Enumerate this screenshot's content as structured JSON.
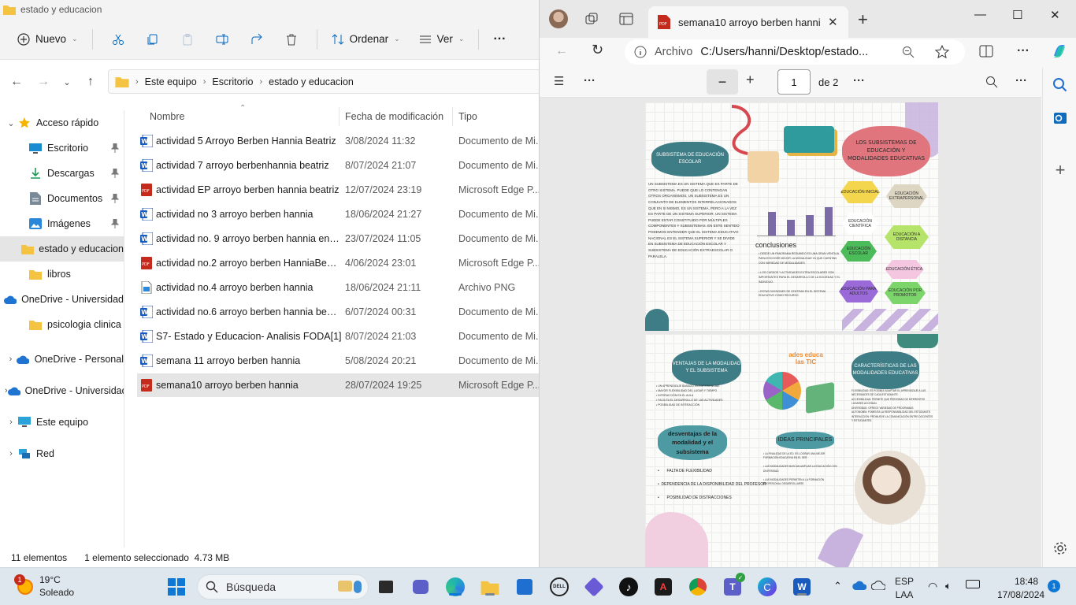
{
  "explorer": {
    "window_title": "estado y educacion",
    "toolbar": {
      "new_label": "Nuevo",
      "sort_label": "Ordenar",
      "view_label": "Ver",
      "more_label": "···"
    },
    "breadcrumb": [
      "Este equipo",
      "Escritorio",
      "estado y educacion"
    ],
    "nav": [
      {
        "label": "Acceso rápido",
        "icon": "star-icon",
        "level": 0,
        "expanded": true
      },
      {
        "label": "Escritorio",
        "icon": "desktop-icon",
        "level": 1,
        "pinned": true
      },
      {
        "label": "Descargas",
        "icon": "download-icon",
        "level": 1,
        "pinned": true
      },
      {
        "label": "Documentos",
        "icon": "document-icon",
        "level": 1,
        "pinned": true
      },
      {
        "label": "Imágenes",
        "icon": "image-icon",
        "level": 1,
        "pinned": true
      },
      {
        "label": "estado y educacion",
        "icon": "folder-icon",
        "level": 1,
        "selected": true
      },
      {
        "label": "libros",
        "icon": "folder-icon",
        "level": 1
      },
      {
        "label": "OneDrive - Universidad",
        "icon": "cloud-icon",
        "level": 1
      },
      {
        "label": "psicologia clinica",
        "icon": "folder-icon",
        "level": 1
      },
      {
        "label": "OneDrive - Personal",
        "icon": "cloud-icon",
        "level": 0
      },
      {
        "label": "OneDrive - Universidad",
        "icon": "cloud-icon",
        "level": 0
      },
      {
        "label": "Este equipo",
        "icon": "pc-icon",
        "level": 0
      },
      {
        "label": "Red",
        "icon": "network-icon",
        "level": 0
      }
    ],
    "columns": {
      "name": "Nombre",
      "date": "Fecha de modificación",
      "type": "Tipo"
    },
    "files": [
      {
        "name": "actividad 5 Arroyo Berben Hannia Beatriz",
        "date": "3/08/2024 11:32",
        "type": "Documento de Mi...",
        "kind": "word"
      },
      {
        "name": "actividad 7 arroyo berbenhannia beatriz",
        "date": "8/07/2024 21:07",
        "type": "Documento de Mi...",
        "kind": "word"
      },
      {
        "name": "actividad EP arroyo berben hannia beatriz",
        "date": "12/07/2024 23:19",
        "type": "Microsoft Edge P...",
        "kind": "pdf"
      },
      {
        "name": "actividad no 3 arroyo berben hannia",
        "date": "18/06/2024 21:27",
        "type": "Documento de Mi...",
        "kind": "word"
      },
      {
        "name": "actividad no. 9 arroyo berben hannia ens...",
        "date": "23/07/2024 11:05",
        "type": "Documento de Mi...",
        "kind": "word"
      },
      {
        "name": "actividad no.2 arroyo berben HanniaBeat...",
        "date": "4/06/2024 23:01",
        "type": "Microsoft Edge P...",
        "kind": "pdf"
      },
      {
        "name": "actividad no.4 arroyo berben hannia",
        "date": "18/06/2024 21:11",
        "type": "Archivo PNG",
        "kind": "png"
      },
      {
        "name": "actividad no.6 arroyo berben hannia beat...",
        "date": "6/07/2024 00:31",
        "type": "Documento de Mi...",
        "kind": "word"
      },
      {
        "name": "S7- Estado y Educacion- Analisis FODA[1]",
        "date": "8/07/2024 21:03",
        "type": "Documento de Mi...",
        "kind": "word"
      },
      {
        "name": "semana 11 arroyo berben hannia",
        "date": "5/08/2024 20:21",
        "type": "Documento de Mi...",
        "kind": "word"
      },
      {
        "name": "semana10 arroyo berben hannia",
        "date": "28/07/2024 19:25",
        "type": "Microsoft Edge P...",
        "kind": "pdf",
        "selected": true
      }
    ],
    "status": {
      "count": "11 elementos",
      "selection": "1 elemento seleccionado  4.73 MB"
    }
  },
  "edge": {
    "tab_title": "semana10 arroyo berben hannia",
    "address_label": "Archivo",
    "address_path": "C:/Users/hanni/Desktop/estado...",
    "pdf": {
      "page": "1",
      "of": "de 2"
    },
    "page1": {
      "cloud_left": "SUBSISTEMA DE EDUCACIÓN ESCOLAR",
      "cloud_right": "LOS SUBSISTEMAS DE EDUCACIÓN Y MODALIDADES EDUCATIVAS",
      "conclusions": "conclusiones",
      "hexes": [
        "EDUCACIÓN INICIAL",
        "EDUCACIÓN EXTRAPERSONAL",
        "EDUCACIÓN CIENTÍFICA",
        "EDUCACIÓN A DISTANCIA",
        "EDUCACIÓN ESCOLAR",
        "EDUCACIÓN ÉTICA",
        "EDUCACIÓN PARA ADULTOS",
        "EDUCACIÓN POR PROMOTOR"
      ]
    },
    "page2": {
      "cloud_left": "VENTAJAS DE LA MODALIDAD Y EL SUBSISTEMA",
      "cloud_right": "CARACTERÍSTICAS DE LAS MODALIDADES EDUCATIVAS",
      "tic_title": "ades educa las TIC",
      "disadvantages_title": "desventajas de la modalidad y el subsistema",
      "disadvantages": [
        "FALTA DE FLEXIBILIDAD",
        "DEPENDENCIA DE LA DISPONIBILIDAD DEL PROFESOR",
        "POSIBILIDAD DE DISTRACCIONES"
      ],
      "ideas_title": "IDEAS PRINCIPALES"
    }
  },
  "taskbar": {
    "weather_temp": "19°C",
    "weather_desc": "Soleado",
    "weather_badge": "1",
    "search_placeholder": "Búsqueda",
    "lang_top": "ESP",
    "lang_bottom": "LAA",
    "time": "18:48",
    "date": "17/08/2024",
    "notif_count": "1"
  },
  "colors": {
    "accent": "#0067c0",
    "pdf_red": "#c42b1c",
    "word_blue": "#185abd",
    "folder_yellow": "#f5c342",
    "teal_cloud": "#3f7d86",
    "pink_cloud": "#e0757e"
  }
}
